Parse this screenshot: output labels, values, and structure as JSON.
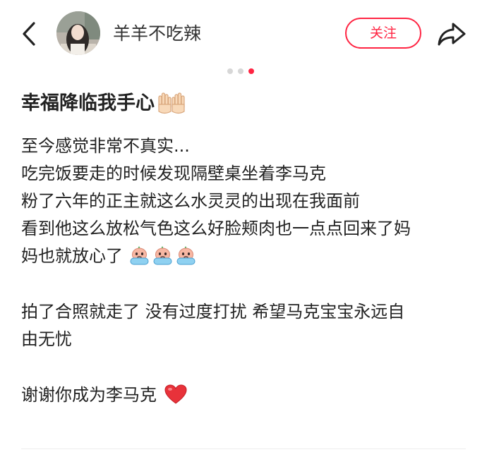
{
  "header": {
    "username": "羊羊不吃辣",
    "follow_label": "关注"
  },
  "carousel": {
    "total": 3,
    "active_index": 2
  },
  "post": {
    "title": "幸福降临我手心",
    "title_emoji": "raising-hands-emoji",
    "lines": {
      "l1": "至今感觉非常不真实...",
      "l2": "吃完饭要走的时候发现隔壁桌坐着李马克",
      "l3": "粉了六年的正主就这么水灵灵的出现在我面前",
      "l4": "看到他这么放松气色这么好脸颊肉也一点点回来了妈",
      "l5": "妈也就放心了",
      "l6": "拍了合照就走了 没有过度打扰 希望马克宝宝永远自",
      "l7": "由无忧",
      "l8": "谢谢你成为李马克"
    },
    "sticker_emoji": "crying-sticker-emoji",
    "heart_emoji": "red-heart-emoji"
  },
  "colors": {
    "accent": "#ff2442",
    "text": "#222222",
    "dot_inactive": "#d7d7d7"
  }
}
